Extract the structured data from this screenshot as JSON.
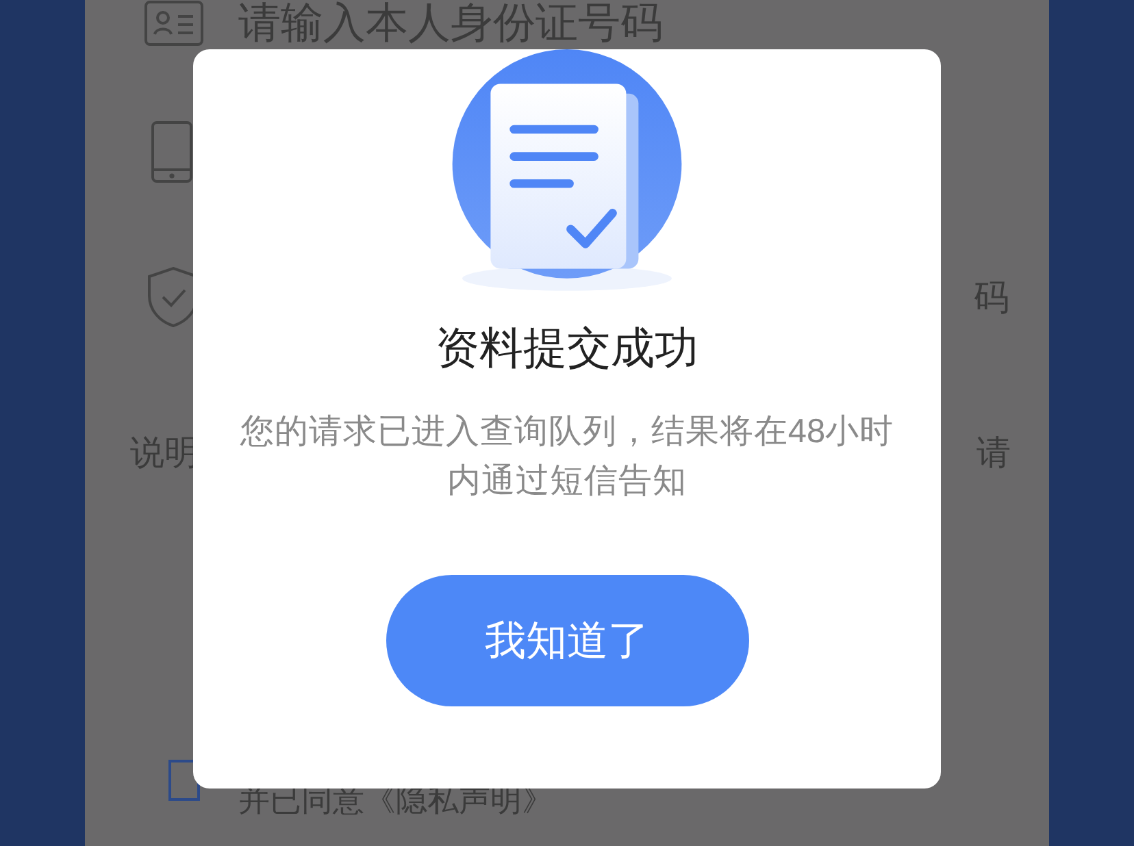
{
  "background": {
    "id_text": "请输入本人身份证号码",
    "code_text": "码",
    "note_left": "说明",
    "note_right": "请",
    "agreement": {
      "checked": false,
      "text": "并已同意《隐私声明》"
    }
  },
  "dialog": {
    "title": "资料提交成功",
    "message": "您的请求已进入查询队列，结果将在48小时内通过短信告知",
    "button": "我知道了"
  }
}
